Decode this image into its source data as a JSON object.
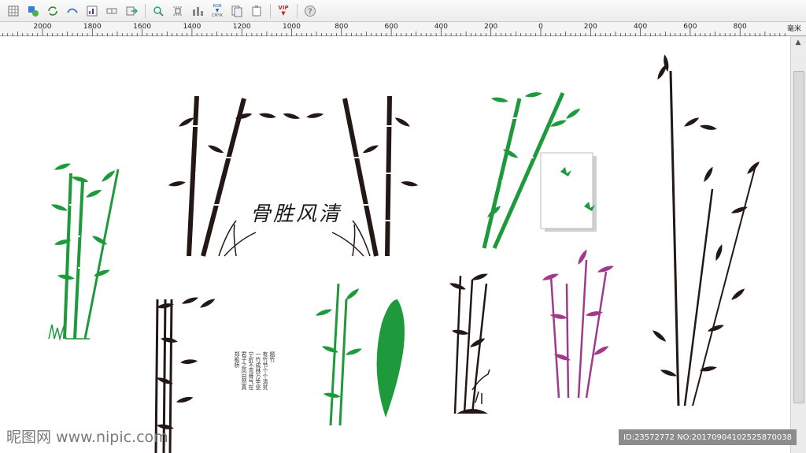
{
  "toolbar": {
    "buttons": [
      {
        "name": "grid-view-icon"
      },
      {
        "name": "object-manager-icon"
      },
      {
        "name": "convert-icon"
      },
      {
        "name": "undo-curve-icon"
      },
      {
        "name": "chart-icon"
      },
      {
        "name": "link-icon"
      },
      {
        "name": "export-icon"
      },
      {
        "name": "zoom-object-icon"
      },
      {
        "name": "align-icon"
      },
      {
        "name": "distribute-icon"
      },
      {
        "name": "rgb-cmyk-icon"
      },
      {
        "name": "copy-page-icon"
      },
      {
        "name": "paste-page-icon"
      },
      {
        "name": "vip-icon"
      },
      {
        "name": "help-icon"
      }
    ],
    "rgb_label": "RGB",
    "cmyk_label": "CMYK",
    "vip_label": "VIP"
  },
  "ruler": {
    "labels": [
      "2000",
      "1800",
      "1600",
      "1400",
      "1200",
      "1000",
      "800",
      "600",
      "400",
      "200",
      "0",
      "200",
      "400",
      "600",
      "800"
    ],
    "unit": "毫米"
  },
  "artwork": {
    "calligraphy": "骨胜风清",
    "poem": "题竹\n有竹节个个清贫\n一竹成林万竿坚\n宁折不弯骨气在\n君子之风自然真\n郑板桥"
  },
  "watermark": {
    "left": "昵图网 www.nipic.com",
    "right": "ID:23572772 NO:20170904102525870038"
  },
  "colors": {
    "green": "#1e9a3c",
    "black": "#231815",
    "magenta": "#a23a8c"
  }
}
